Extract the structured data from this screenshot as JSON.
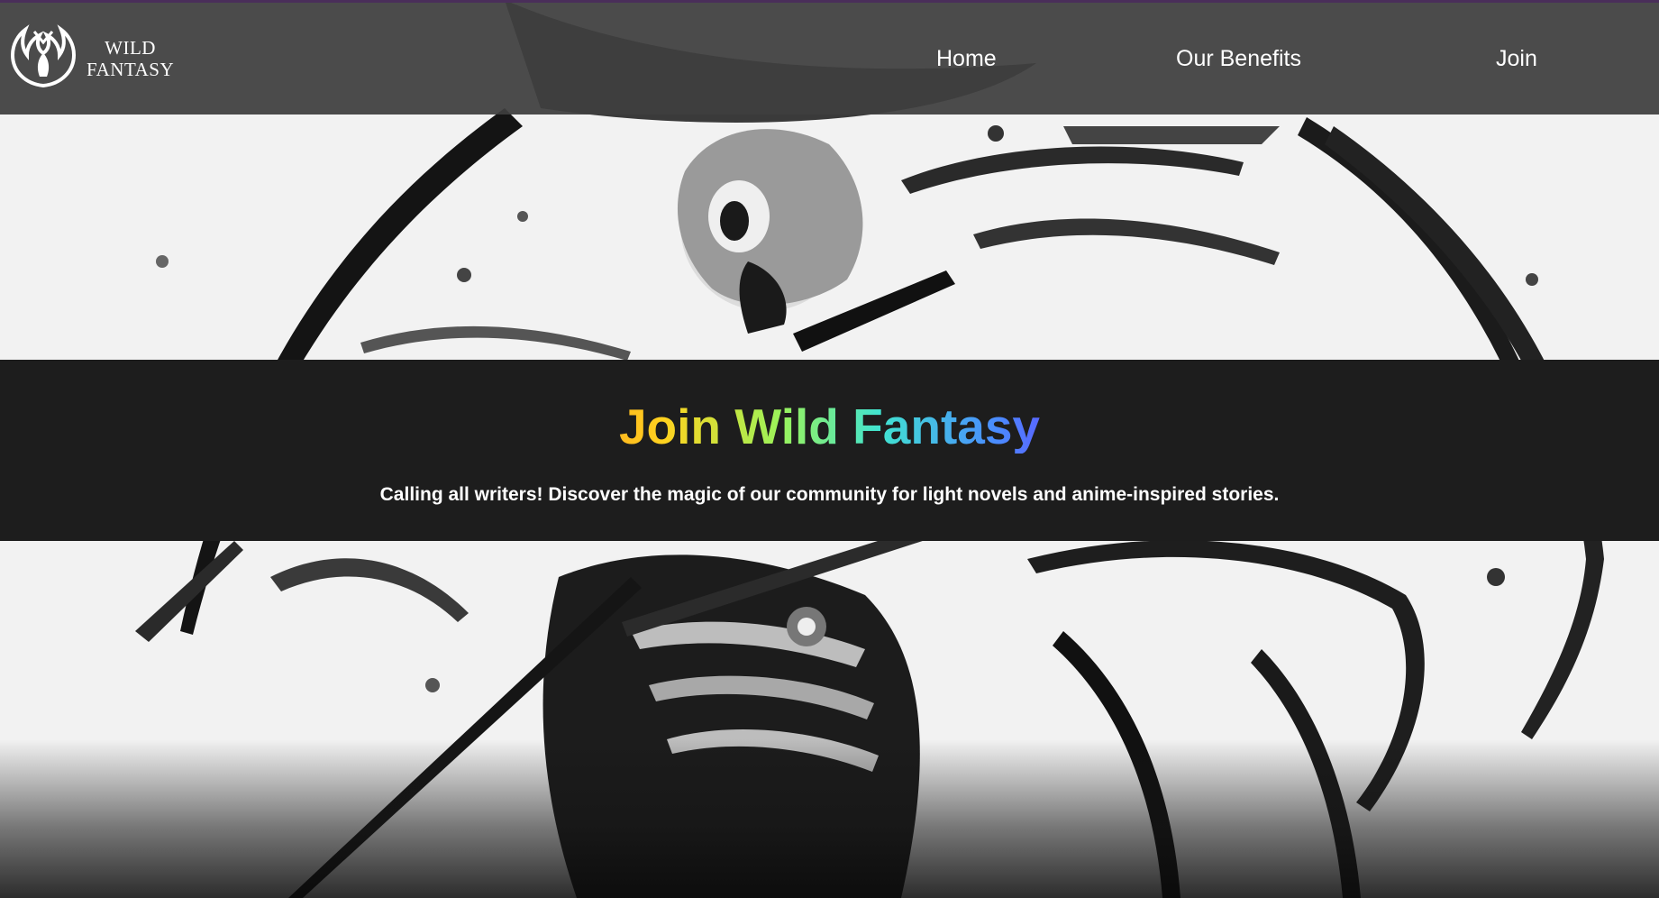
{
  "brand": {
    "logo_icon": "dragon-emblem-icon",
    "name_line1": "WILD",
    "name_line2": "FANTASY"
  },
  "nav": {
    "home": "Home",
    "benefits": "Our Benefits",
    "join": "Join"
  },
  "hero": {
    "title": "Join Wild Fantasy",
    "subtitle": "Calling all writers! Discover the magic of our community for light novels and anime-inspired stories.",
    "background_image": "ink-style anime swordsman artwork"
  },
  "colors": {
    "navbar": "#3e3e3e",
    "banner": "#1d1d1d",
    "page_background": "#f2f2f2",
    "title_gradient": [
      "#ff3b3b",
      "#ff8a1e",
      "#ffd21f",
      "#9af25a",
      "#41e3d0",
      "#4a8cff",
      "#6a3bff",
      "#c64bff"
    ]
  }
}
